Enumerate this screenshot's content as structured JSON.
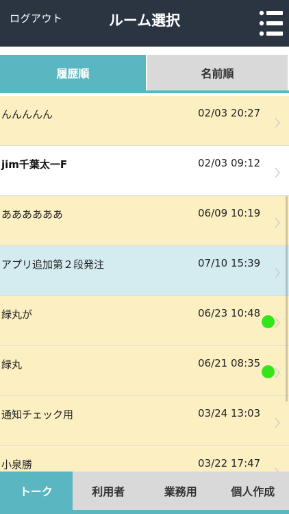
{
  "header": {
    "logout_label": "ログアウト",
    "title": "ルーム選択",
    "menu_icon": "menu-list-icon",
    "background": "#2b3441"
  },
  "sort_tabs": [
    {
      "label": "履歴順",
      "active": true
    },
    {
      "label": "名前順",
      "active": false
    }
  ],
  "rooms": [
    {
      "name": "んんんんん",
      "time": "02/03 20:27",
      "bg": "#fcf0c3",
      "bold": false,
      "unread": false
    },
    {
      "name": "jim千葉太一F",
      "time": "02/03 09:12",
      "bg": "#ffffff",
      "bold": true,
      "unread": false
    },
    {
      "name": "ああああああ",
      "time": "06/09 10:19",
      "bg": "#fcf0c3",
      "bold": false,
      "unread": false
    },
    {
      "name": "アプリ追加第２段発注",
      "time": "07/10 15:39",
      "bg": "#d4ebf0",
      "bold": false,
      "unread": false
    },
    {
      "name": "緑丸が",
      "time": "06/23 10:48",
      "bg": "#fcf0c3",
      "bold": false,
      "unread": true
    },
    {
      "name": "緑丸",
      "time": "06/21 08:35",
      "bg": "#fcf0c3",
      "bold": false,
      "unread": true
    },
    {
      "name": "通知チェック用",
      "time": "03/24 13:03",
      "bg": "#fcf0c3",
      "bold": false,
      "unread": false
    },
    {
      "name": "小泉勝",
      "time": "03/22 17:47",
      "bg": "#fcf0c3",
      "bold": false,
      "unread": false
    }
  ],
  "bottom_tabs": [
    {
      "label": "トーク",
      "active": true
    },
    {
      "label": "利用者",
      "active": false
    },
    {
      "label": "業務用",
      "active": false
    },
    {
      "label": "個人作成",
      "active": false
    }
  ],
  "colors": {
    "accent": "#5ab7c2",
    "unread_dot": "#33e61a",
    "inactive_tab": "#d9d9d9"
  }
}
